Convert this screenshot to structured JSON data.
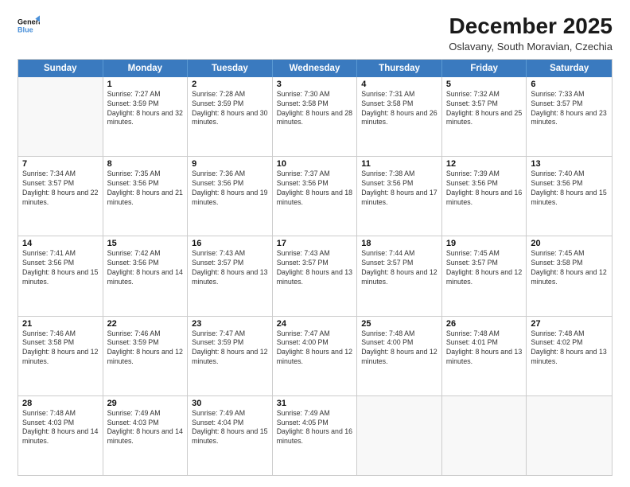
{
  "logo": {
    "line1": "General",
    "line2": "Blue"
  },
  "header": {
    "month": "December 2025",
    "location": "Oslavany, South Moravian, Czechia"
  },
  "days": [
    "Sunday",
    "Monday",
    "Tuesday",
    "Wednesday",
    "Thursday",
    "Friday",
    "Saturday"
  ],
  "rows": [
    [
      {
        "day": "",
        "empty": true
      },
      {
        "day": "1",
        "sunrise": "Sunrise: 7:27 AM",
        "sunset": "Sunset: 3:59 PM",
        "daylight": "Daylight: 8 hours and 32 minutes."
      },
      {
        "day": "2",
        "sunrise": "Sunrise: 7:28 AM",
        "sunset": "Sunset: 3:59 PM",
        "daylight": "Daylight: 8 hours and 30 minutes."
      },
      {
        "day": "3",
        "sunrise": "Sunrise: 7:30 AM",
        "sunset": "Sunset: 3:58 PM",
        "daylight": "Daylight: 8 hours and 28 minutes."
      },
      {
        "day": "4",
        "sunrise": "Sunrise: 7:31 AM",
        "sunset": "Sunset: 3:58 PM",
        "daylight": "Daylight: 8 hours and 26 minutes."
      },
      {
        "day": "5",
        "sunrise": "Sunrise: 7:32 AM",
        "sunset": "Sunset: 3:57 PM",
        "daylight": "Daylight: 8 hours and 25 minutes."
      },
      {
        "day": "6",
        "sunrise": "Sunrise: 7:33 AM",
        "sunset": "Sunset: 3:57 PM",
        "daylight": "Daylight: 8 hours and 23 minutes."
      }
    ],
    [
      {
        "day": "7",
        "sunrise": "Sunrise: 7:34 AM",
        "sunset": "Sunset: 3:57 PM",
        "daylight": "Daylight: 8 hours and 22 minutes."
      },
      {
        "day": "8",
        "sunrise": "Sunrise: 7:35 AM",
        "sunset": "Sunset: 3:56 PM",
        "daylight": "Daylight: 8 hours and 21 minutes."
      },
      {
        "day": "9",
        "sunrise": "Sunrise: 7:36 AM",
        "sunset": "Sunset: 3:56 PM",
        "daylight": "Daylight: 8 hours and 19 minutes."
      },
      {
        "day": "10",
        "sunrise": "Sunrise: 7:37 AM",
        "sunset": "Sunset: 3:56 PM",
        "daylight": "Daylight: 8 hours and 18 minutes."
      },
      {
        "day": "11",
        "sunrise": "Sunrise: 7:38 AM",
        "sunset": "Sunset: 3:56 PM",
        "daylight": "Daylight: 8 hours and 17 minutes."
      },
      {
        "day": "12",
        "sunrise": "Sunrise: 7:39 AM",
        "sunset": "Sunset: 3:56 PM",
        "daylight": "Daylight: 8 hours and 16 minutes."
      },
      {
        "day": "13",
        "sunrise": "Sunrise: 7:40 AM",
        "sunset": "Sunset: 3:56 PM",
        "daylight": "Daylight: 8 hours and 15 minutes."
      }
    ],
    [
      {
        "day": "14",
        "sunrise": "Sunrise: 7:41 AM",
        "sunset": "Sunset: 3:56 PM",
        "daylight": "Daylight: 8 hours and 15 minutes."
      },
      {
        "day": "15",
        "sunrise": "Sunrise: 7:42 AM",
        "sunset": "Sunset: 3:56 PM",
        "daylight": "Daylight: 8 hours and 14 minutes."
      },
      {
        "day": "16",
        "sunrise": "Sunrise: 7:43 AM",
        "sunset": "Sunset: 3:57 PM",
        "daylight": "Daylight: 8 hours and 13 minutes."
      },
      {
        "day": "17",
        "sunrise": "Sunrise: 7:43 AM",
        "sunset": "Sunset: 3:57 PM",
        "daylight": "Daylight: 8 hours and 13 minutes."
      },
      {
        "day": "18",
        "sunrise": "Sunrise: 7:44 AM",
        "sunset": "Sunset: 3:57 PM",
        "daylight": "Daylight: 8 hours and 12 minutes."
      },
      {
        "day": "19",
        "sunrise": "Sunrise: 7:45 AM",
        "sunset": "Sunset: 3:57 PM",
        "daylight": "Daylight: 8 hours and 12 minutes."
      },
      {
        "day": "20",
        "sunrise": "Sunrise: 7:45 AM",
        "sunset": "Sunset: 3:58 PM",
        "daylight": "Daylight: 8 hours and 12 minutes."
      }
    ],
    [
      {
        "day": "21",
        "sunrise": "Sunrise: 7:46 AM",
        "sunset": "Sunset: 3:58 PM",
        "daylight": "Daylight: 8 hours and 12 minutes."
      },
      {
        "day": "22",
        "sunrise": "Sunrise: 7:46 AM",
        "sunset": "Sunset: 3:59 PM",
        "daylight": "Daylight: 8 hours and 12 minutes."
      },
      {
        "day": "23",
        "sunrise": "Sunrise: 7:47 AM",
        "sunset": "Sunset: 3:59 PM",
        "daylight": "Daylight: 8 hours and 12 minutes."
      },
      {
        "day": "24",
        "sunrise": "Sunrise: 7:47 AM",
        "sunset": "Sunset: 4:00 PM",
        "daylight": "Daylight: 8 hours and 12 minutes."
      },
      {
        "day": "25",
        "sunrise": "Sunrise: 7:48 AM",
        "sunset": "Sunset: 4:00 PM",
        "daylight": "Daylight: 8 hours and 12 minutes."
      },
      {
        "day": "26",
        "sunrise": "Sunrise: 7:48 AM",
        "sunset": "Sunset: 4:01 PM",
        "daylight": "Daylight: 8 hours and 13 minutes."
      },
      {
        "day": "27",
        "sunrise": "Sunrise: 7:48 AM",
        "sunset": "Sunset: 4:02 PM",
        "daylight": "Daylight: 8 hours and 13 minutes."
      }
    ],
    [
      {
        "day": "28",
        "sunrise": "Sunrise: 7:48 AM",
        "sunset": "Sunset: 4:03 PM",
        "daylight": "Daylight: 8 hours and 14 minutes."
      },
      {
        "day": "29",
        "sunrise": "Sunrise: 7:49 AM",
        "sunset": "Sunset: 4:03 PM",
        "daylight": "Daylight: 8 hours and 14 minutes."
      },
      {
        "day": "30",
        "sunrise": "Sunrise: 7:49 AM",
        "sunset": "Sunset: 4:04 PM",
        "daylight": "Daylight: 8 hours and 15 minutes."
      },
      {
        "day": "31",
        "sunrise": "Sunrise: 7:49 AM",
        "sunset": "Sunset: 4:05 PM",
        "daylight": "Daylight: 8 hours and 16 minutes."
      },
      {
        "day": "",
        "empty": true
      },
      {
        "day": "",
        "empty": true
      },
      {
        "day": "",
        "empty": true
      }
    ]
  ]
}
